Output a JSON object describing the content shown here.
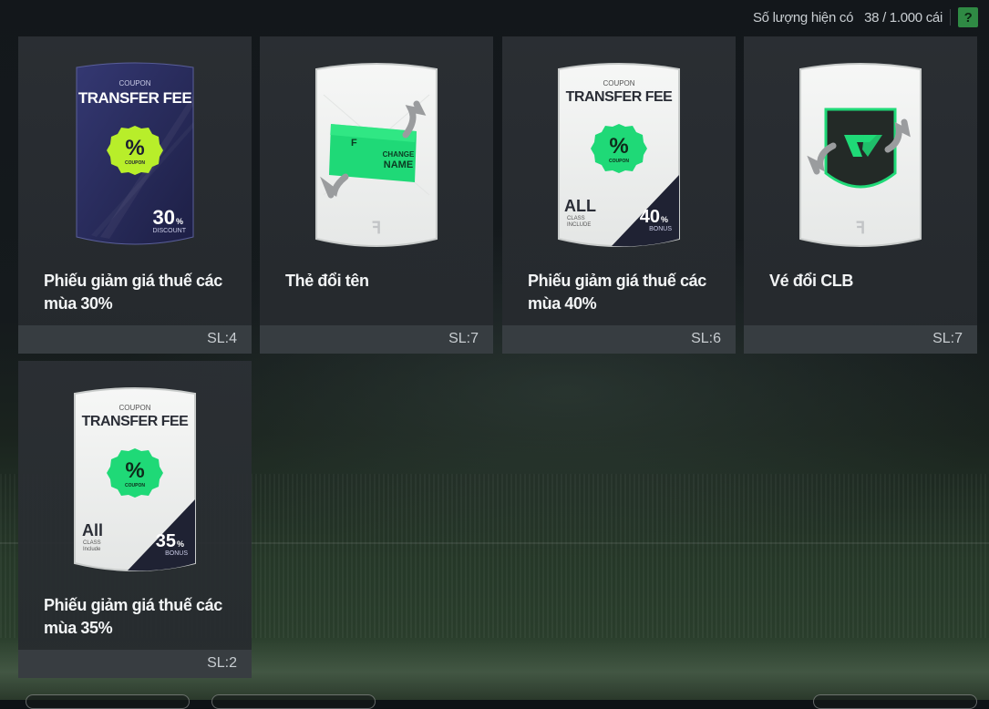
{
  "header": {
    "capacity_label": "Số lượng hiện có",
    "capacity_value": "38 / 1.000 cái",
    "help_label": "?"
  },
  "items": [
    {
      "name": "Phiếu giảm giá thuế các mùa 30%",
      "qty": "SL:4",
      "card": {
        "top_small": "COUPON",
        "top_big": "TRANSFER FEE",
        "badge_text": "COUPON",
        "percent": "30",
        "percent_unit": "%",
        "percent_label": "DISCOUNT",
        "style": "dark-purple"
      }
    },
    {
      "name": "Thẻ đổi tên",
      "qty": "SL:7",
      "card": {
        "ticket_line1": "CHANGE",
        "ticket_line2": "NAME",
        "style": "white"
      }
    },
    {
      "name": "Phiếu giảm giá thuế các mùa 40%",
      "qty": "SL:6",
      "card": {
        "top_small": "COUPON",
        "top_big": "TRANSFER FEE",
        "badge_text": "COUPON",
        "class_big": "ALL",
        "class_small1": "CLASS",
        "class_small2": "INCLUDE",
        "percent": "40",
        "percent_unit": "%",
        "percent_label": "BONUS",
        "style": "white"
      }
    },
    {
      "name": "Vé đổi CLB",
      "qty": "SL:7",
      "card": {
        "style": "white"
      }
    },
    {
      "name": "Phiếu giảm giá thuế các mùa 35%",
      "qty": "SL:2",
      "card": {
        "top_small": "COUPON",
        "top_big": "TRANSFER FEE",
        "badge_text": "COUPON",
        "class_big": "All",
        "class_small1": "CLASS",
        "class_small2": "Include",
        "percent": "35",
        "percent_unit": "%",
        "percent_label": "BONUS",
        "style": "white"
      }
    }
  ],
  "colors": {
    "accent_green": "#1fd977",
    "lime": "#b8ee2a",
    "dark_card": "#2b2d59",
    "help_green": "#2f8a44"
  }
}
